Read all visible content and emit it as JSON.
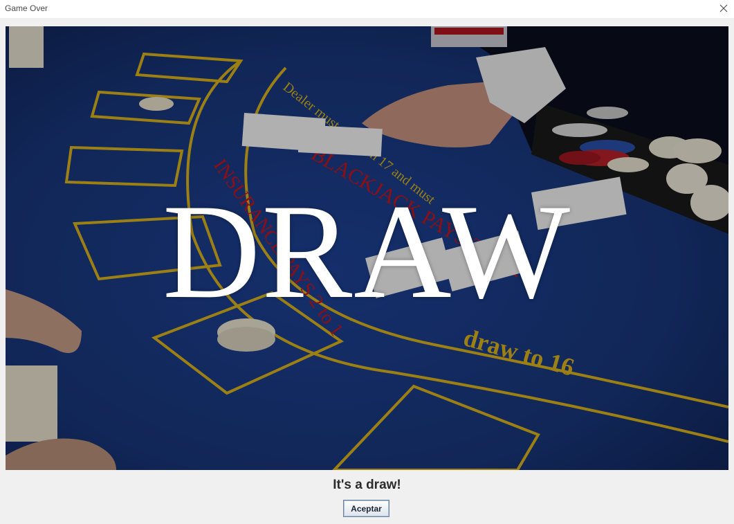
{
  "window": {
    "title": "Game Over",
    "close_icon": "close-icon"
  },
  "image": {
    "overlay_text": "DRAW",
    "table_text": {
      "rule_line_1": "Dealer must stand on 17 and must draw to 16",
      "rule_short": "draw to 16",
      "rule_start": "Dealer must stand on 17 and must",
      "payout_text": "BLACKJACK PAYS 3 TO 2",
      "payout_short": "TO 2",
      "insurance_text": "INSURANCE PAYS 2 to 1",
      "insurance_short": "to 1"
    },
    "colors": {
      "felt": "#1a3a8a",
      "line_yellow": "#d8b21c",
      "text_red": "#c4161c",
      "overlay_text": "#ffffff"
    }
  },
  "dialog": {
    "message": "It's a draw!",
    "ok_label": "Aceptar"
  }
}
